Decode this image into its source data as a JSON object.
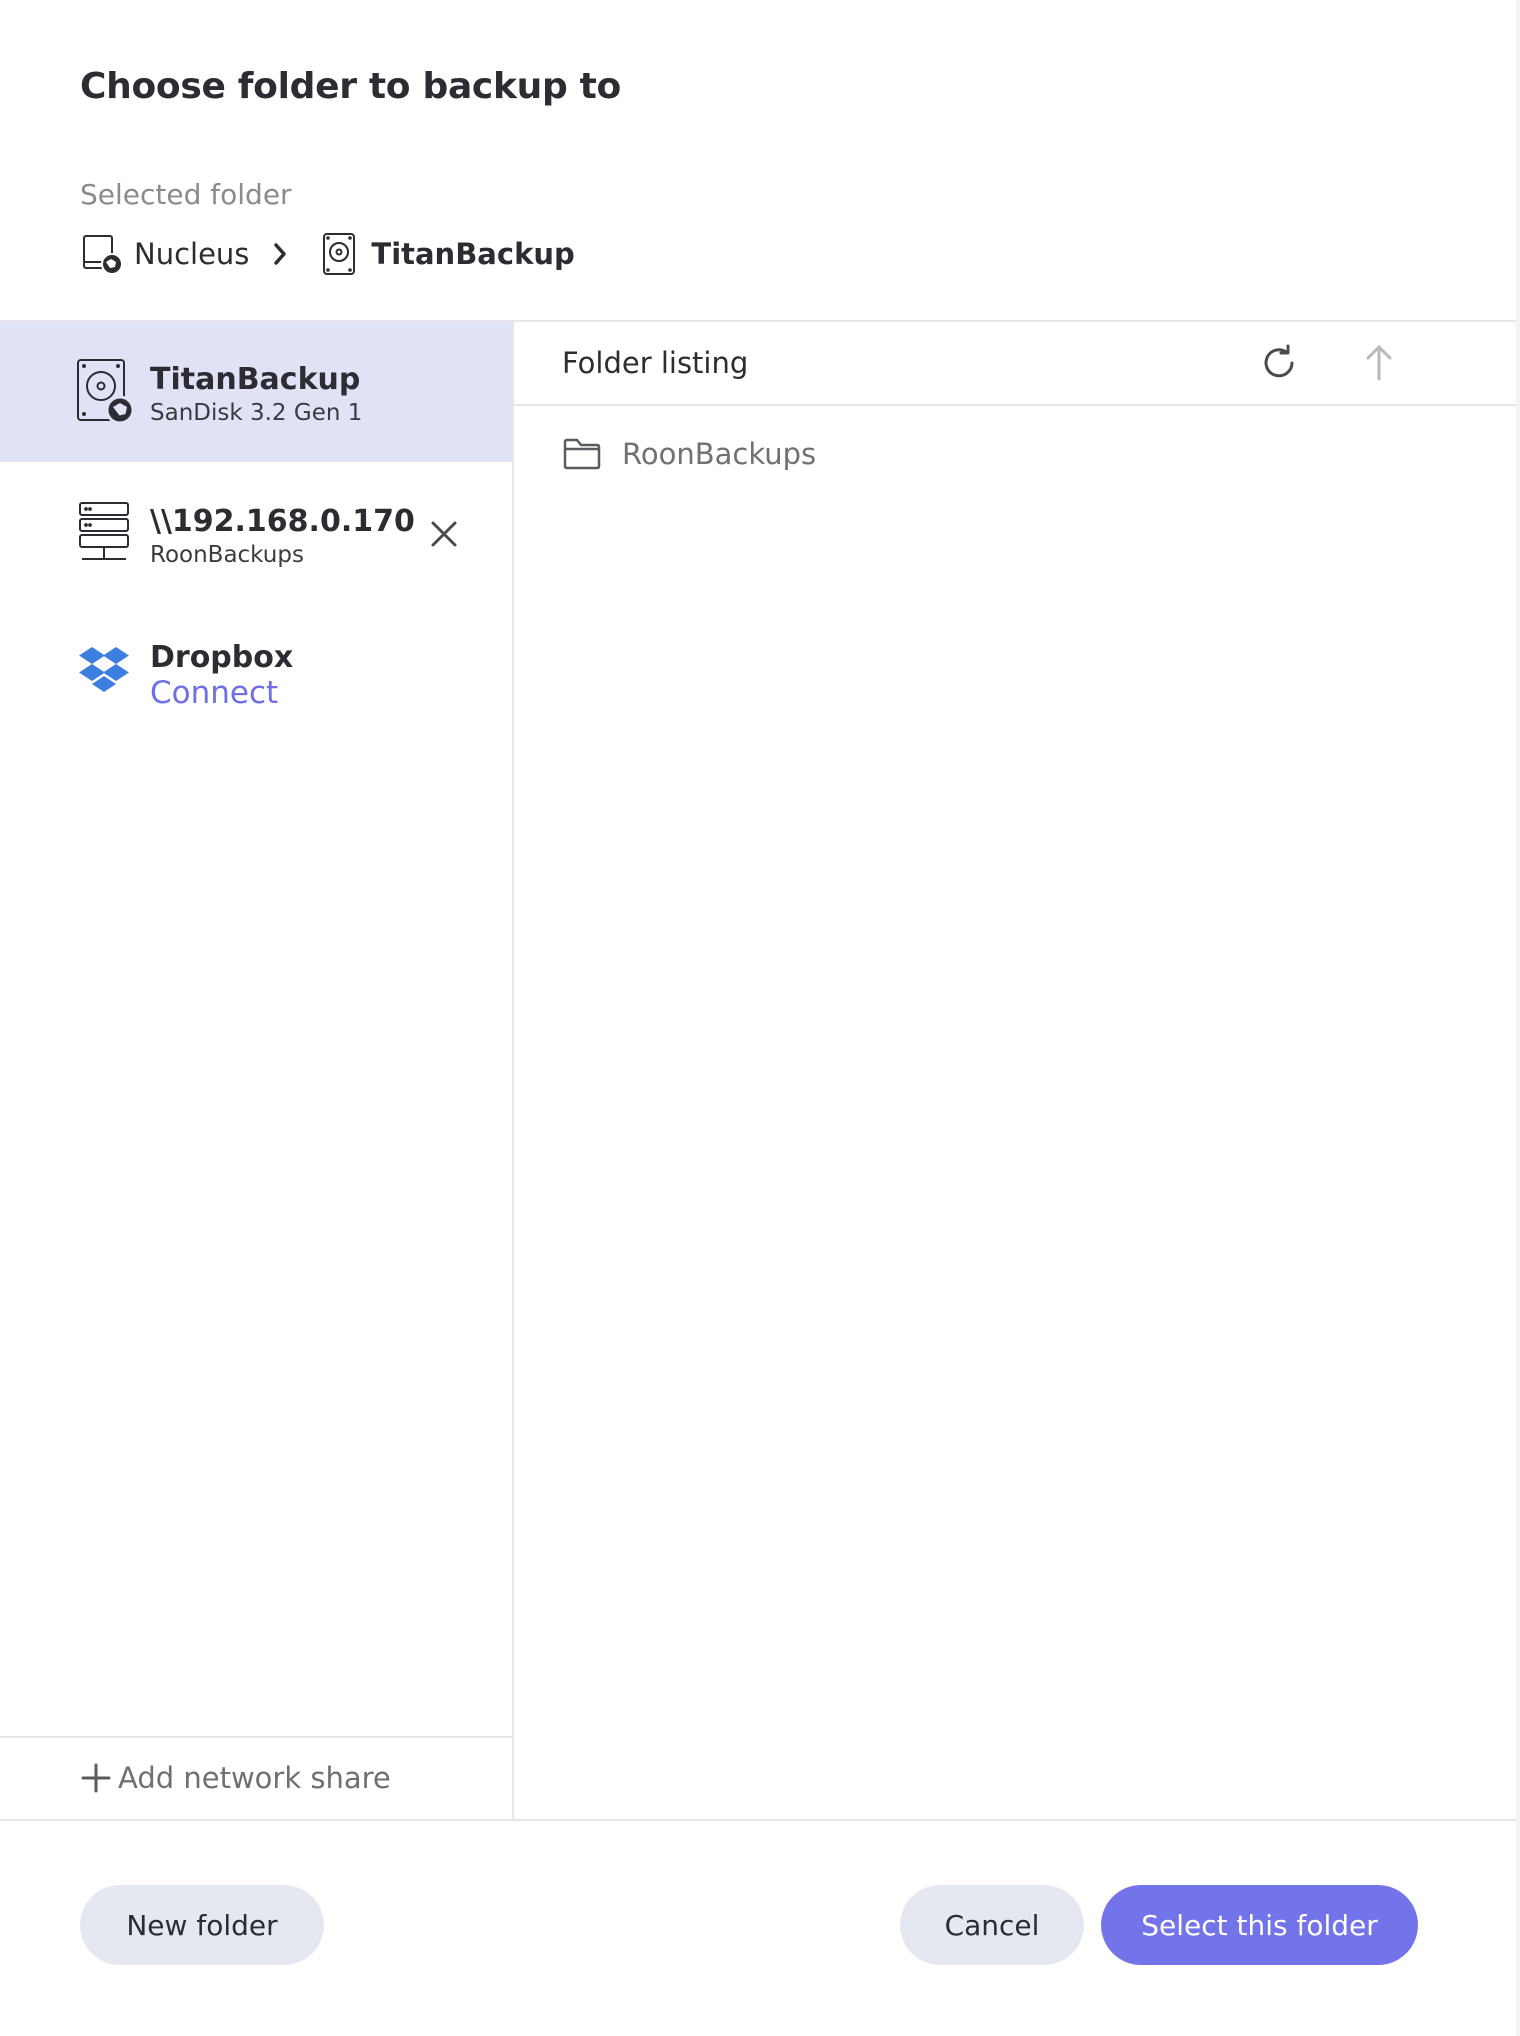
{
  "dialog": {
    "title": "Choose folder to backup to",
    "selected_label": "Selected folder",
    "breadcrumb": [
      {
        "label": "Nucleus",
        "icon": "nucleus-device-icon"
      },
      {
        "label": "TitanBackup",
        "icon": "hard-drive-icon"
      }
    ]
  },
  "sidebar": {
    "locations": [
      {
        "name": "TitanBackup",
        "subtitle": "SanDisk 3.2 Gen 1",
        "icon": "usb-drive-icon",
        "selected": true
      },
      {
        "name": "\\\\192.168.0.170",
        "subtitle": "RoonBackups",
        "icon": "network-server-icon",
        "removable": true
      },
      {
        "name": "Dropbox",
        "action": "Connect",
        "icon": "dropbox-icon"
      }
    ],
    "add_share_label": "Add network share"
  },
  "listing": {
    "title": "Folder listing",
    "folders": [
      {
        "name": "RoonBackups"
      }
    ]
  },
  "footer": {
    "new_folder": "New folder",
    "cancel": "Cancel",
    "select": "Select this folder"
  },
  "colors": {
    "accent": "#7474ea",
    "selected_bg": "#e2e2f7",
    "secondary_button": "#e5e8f1",
    "dropbox": "#3d7fe0"
  }
}
